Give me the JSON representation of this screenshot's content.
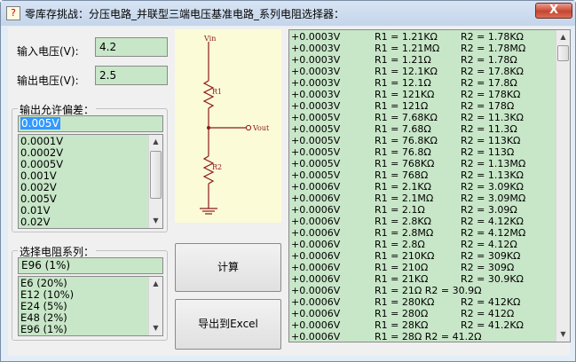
{
  "window": {
    "title": "零库存挑战：分压电路_并联型三端电压基准电路_系列电阻选择器：",
    "close_label": "X",
    "app_icon": "?"
  },
  "inputs": {
    "vin_label": "输入电压(V):",
    "vin_value": "4.2",
    "vout_label": "输出电压(V):",
    "vout_value": "2.5"
  },
  "tolerance": {
    "caption": "输出允许偏差：",
    "selected": "0.005V",
    "options": [
      "0.0001V",
      "0.0002V",
      "0.0005V",
      "0.001V",
      "0.002V",
      "0.005V",
      "0.01V",
      "0.02V"
    ]
  },
  "series": {
    "caption": "选择电阻系列：",
    "selected": "E96 (1%)",
    "options": [
      "E6  (20%)",
      "E12 (10%)",
      "E24 (5%)",
      "E48 (2%)",
      "E96 (1%)"
    ]
  },
  "buttons": {
    "calc": "计算",
    "export": "导出到Excel"
  },
  "circuit": {
    "vin": "Vin",
    "r1": "R1",
    "r2": "R2",
    "vout": "Vout"
  },
  "results": [
    [
      "+0.0003V",
      "R1 = 1.21KΩ",
      "R2 = 1.78KΩ"
    ],
    [
      "+0.0003V",
      "R1 = 1.21MΩ",
      "R2 = 1.78MΩ"
    ],
    [
      "+0.0003V",
      "R1 = 1.21Ω",
      "R2 = 1.78Ω"
    ],
    [
      "+0.0003V",
      "R1 = 12.1KΩ",
      "R2 = 17.8KΩ"
    ],
    [
      "+0.0003V",
      "R1 = 12.1Ω",
      "R2 = 17.8Ω"
    ],
    [
      "+0.0003V",
      "R1 = 121KΩ",
      "R2 = 178KΩ"
    ],
    [
      "+0.0003V",
      "R1 = 121Ω",
      "R2 = 178Ω"
    ],
    [
      "+0.0005V",
      "R1 = 7.68KΩ",
      "R2 = 11.3KΩ"
    ],
    [
      "+0.0005V",
      "R1 = 7.68Ω",
      "R2 = 11.3Ω"
    ],
    [
      "+0.0005V",
      "R1 = 76.8KΩ",
      "R2 = 113KΩ"
    ],
    [
      "+0.0005V",
      "R1 = 76.8Ω",
      "R2 = 113Ω"
    ],
    [
      "+0.0005V",
      "R1 = 768KΩ",
      "R2 = 1.13MΩ"
    ],
    [
      "+0.0005V",
      "R1 = 768Ω",
      "R2 = 1.13KΩ"
    ],
    [
      "+0.0006V",
      "R1 = 2.1KΩ",
      "R2 = 3.09KΩ"
    ],
    [
      "+0.0006V",
      "R1 = 2.1MΩ",
      "R2 = 3.09MΩ"
    ],
    [
      "+0.0006V",
      "R1 = 2.1Ω",
      "R2 = 3.09Ω"
    ],
    [
      "+0.0006V",
      "R1 = 2.8KΩ",
      "R2 = 4.12KΩ"
    ],
    [
      "+0.0006V",
      "R1 = 2.8MΩ",
      "R2 = 4.12MΩ"
    ],
    [
      "+0.0006V",
      "R1 = 2.8Ω",
      "R2 = 4.12Ω"
    ],
    [
      "+0.0006V",
      "R1 = 210KΩ",
      "R2 = 309KΩ"
    ],
    [
      "+0.0006V",
      "R1 = 210Ω",
      "R2 = 309Ω"
    ],
    [
      "+0.0006V",
      "R1 = 21KΩ",
      "R2 = 30.9KΩ"
    ],
    [
      "+0.0006V",
      "R1 = 21Ω R2 = 30.9Ω",
      ""
    ],
    [
      "+0.0006V",
      "R1 = 280KΩ",
      "R2 = 412KΩ"
    ],
    [
      "+0.0006V",
      "R1 = 280Ω",
      "R2 = 412Ω"
    ],
    [
      "+0.0006V",
      "R1 = 28KΩ",
      "R2 = 41.2KΩ"
    ],
    [
      "+0.0006V",
      "R1 = 28Ω R2 = 41.2Ω",
      ""
    ]
  ]
}
